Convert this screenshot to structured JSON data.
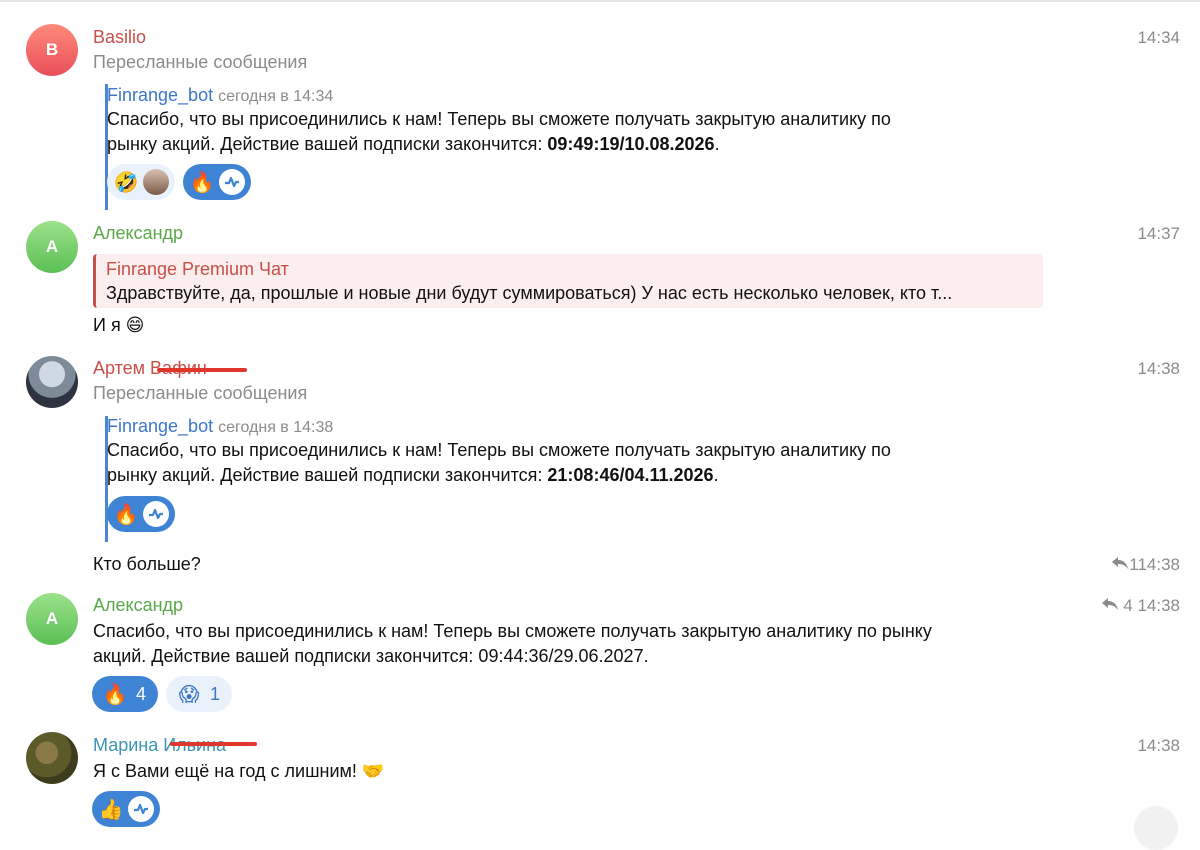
{
  "messages": [
    {
      "author": "Basilio",
      "avatar_letter": "B",
      "time": "14:34",
      "forwarded_label": "Пересланные сообщения",
      "fwd": {
        "from": "Finrange_bot",
        "date": "сегодня в 14:34",
        "line1": "Спасибо, что вы присоединились к нам! Теперь вы сможете получать закрытую аналитику по",
        "line2_prefix": "рынку акций. Действие вашей подписки закончится: ",
        "line2_bold": "09:49:19/10.08.2026",
        "line2_suffix": ".",
        "reactions": [
          "🤣",
          "🔥"
        ]
      }
    },
    {
      "author": "Александр",
      "avatar_letter": "А",
      "time": "14:37",
      "quote_title": "Finrange Premium Чат",
      "quote_text": "Здравствуйте, да, прошлые и новые дни будут суммироваться) У нас есть несколько человек, кто т...",
      "text": "И я 😄"
    },
    {
      "author": "Артем Вафин",
      "time": "14:38",
      "forwarded_label": "Пересланные сообщения",
      "fwd": {
        "from": "Finrange_bot",
        "date": "сегодня в 14:38",
        "line1": "Спасибо, что вы присоединились к нам! Теперь вы сможете получать закрытую аналитику по",
        "line2_prefix": "рынку акций. Действие вашей подписки закончится: ",
        "line2_bold": "21:08:46/04.11.2026",
        "line2_suffix": ".",
        "reactions": [
          "🔥"
        ]
      },
      "followup_text": "Кто больше?",
      "followup_fwd_count": "1",
      "followup_time": "14:38"
    },
    {
      "author": "Александр",
      "avatar_letter": "А",
      "fwd_count": "4",
      "time": "14:38",
      "line1": "Спасибо, что вы присоединились к нам! Теперь вы сможете получать закрытую аналитику по рынку",
      "line2": "акций. Действие вашей подписки закончится: 09:44:36/29.06.2027.",
      "reactions": [
        {
          "emoji": "🔥",
          "count": "4"
        },
        {
          "emoji": "😱",
          "count": "1"
        }
      ]
    },
    {
      "author": "Марина Ильина",
      "time": "14:38",
      "text": "Я с Вами ещё на год с лишним! 🤝",
      "reactions": [
        "👍"
      ]
    }
  ]
}
